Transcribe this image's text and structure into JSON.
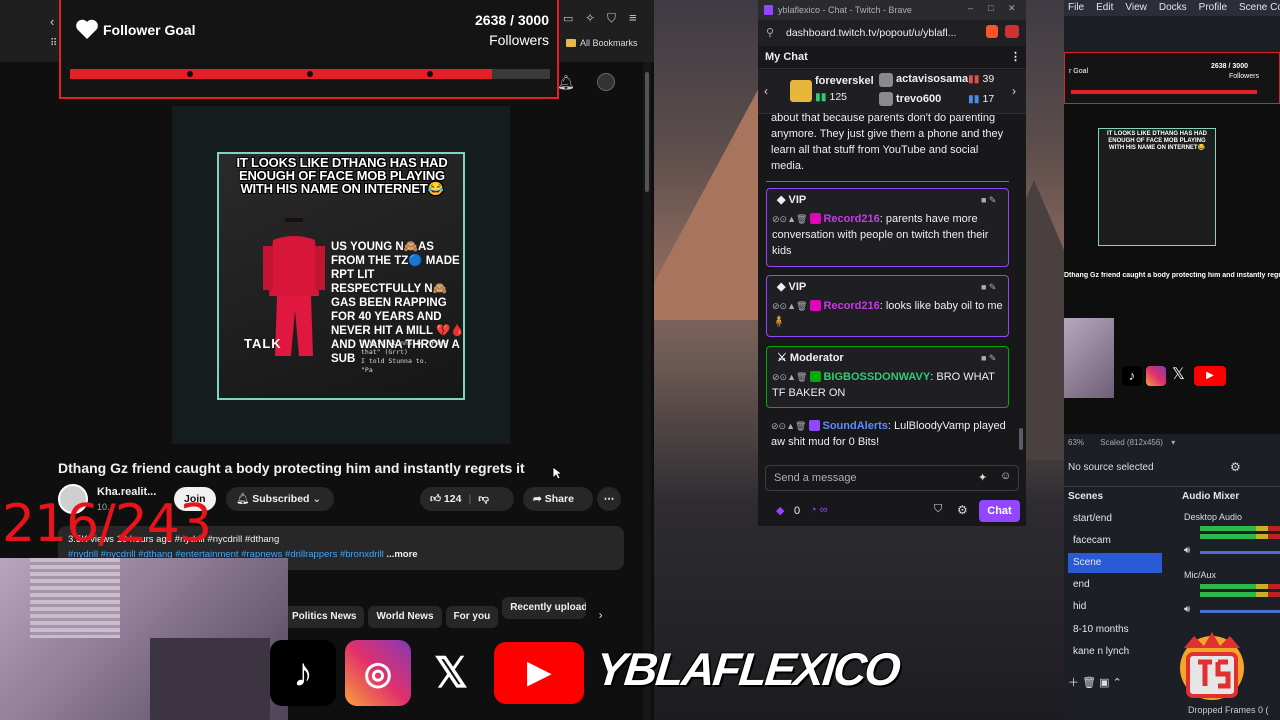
{
  "follower_goal": {
    "title": "Follower Goal",
    "current": "2638",
    "target": "/ 3000",
    "unit": "Followers",
    "progress": 0.879
  },
  "youtube": {
    "bookmarks_label": "All Bookmarks",
    "video": {
      "thumb_headline": "IT LOOKS LIKE DTHANG HAS HAD ENOUGH OF FACE MOB PLAYING WITH HIS NAME ON INTERNET😂",
      "thumb_right_text": "US YOUNG N🙈AS FROM THE TZ🔵 MADE RPT LIT RESPECTFULLY N🙈GAS BEEN RAPPING FOR 40 YEARS AND NEVER HIT A MILL 💔🩸 AND WANNA THROW A SUB",
      "thumb_mono": "I told Stunna to \"Pass that\" (Grrt)\nI told Stunna to.\n\"Pa",
      "thumb_talk": "TALK",
      "title": "Dthang Gz friend caught a body protecting him and instantly regrets it"
    },
    "channel": {
      "name": "Kha.realit...",
      "subs": "10..."
    },
    "buttons": {
      "join": "Join",
      "subscribed": "Subscribed",
      "likes": "124",
      "share": "Share"
    },
    "description": {
      "line1": "3.5K views  10 hours ago  #nydrill #nycdrill #dthang",
      "line2": "#nydrill #nycdrill #dthang #entertainment #rapnews #drillrappers #bronxdrill",
      "more": "...more"
    },
    "chips": [
      "Politics News",
      "World News",
      "For you",
      "Recently uploaded"
    ]
  },
  "overlay": {
    "sub_counter": "216/243",
    "brand": "YBLAFLEXICO",
    "socials": [
      "tiktok-icon",
      "instagram-icon",
      "x-icon",
      "youtube-icon"
    ]
  },
  "chat": {
    "window_title": "yblaflexico - Chat - Twitch - Brave",
    "url": "dashboard.twitch.tv/popout/u/yblafl...",
    "header": "My Chat",
    "gifters": [
      {
        "name": "foreverskel",
        "count": "125"
      },
      {
        "name": "actavisosama",
        "count": "39"
      },
      {
        "name": "trevo600",
        "count": "17"
      }
    ],
    "intro_text": "about that because parents don't do parenting anymore. They just give them a phone and they learn all that stuff from YouTube and social media.",
    "messages": [
      {
        "badge": "VIP",
        "user": "Record216",
        "text": ": parents have more conversation with people on twitch then their kids"
      },
      {
        "badge": "VIP",
        "user": "Record216",
        "text": ": looks like baby oil to me🧍"
      },
      {
        "badge": "Moderator",
        "user": "BIGBOSSDONWAVY",
        "text": ": BRO WHAT TF BAKER ON"
      }
    ],
    "alert": {
      "user": "SoundAlerts",
      "text": ": LulBloodyVamp played aw shit mud for 0 Bits!"
    },
    "input_placeholder": "Send a message",
    "points": "0",
    "send_label": "Chat"
  },
  "obs": {
    "menu": [
      "File",
      "Edit",
      "View",
      "Docks",
      "Profile",
      "Scene Colle"
    ],
    "preview_goal_label": "r Goal",
    "preview_count": "2638 / 3000",
    "preview_unit": "Followers",
    "zoom": "63%",
    "scale": "Scaled (812x456)",
    "no_source": "No source selected",
    "scenes_title": "Scenes",
    "mixer_title": "Audio Mixer",
    "scenes": [
      "start/end",
      "facecam",
      "Scene",
      "end",
      "hid",
      "8-10 months",
      "kane n lynch"
    ],
    "active_scene": "Scene",
    "mixer_channels": [
      "Desktop Audio",
      "Mic/Aux"
    ],
    "dropped_frames": "Dropped Frames 0 ("
  }
}
